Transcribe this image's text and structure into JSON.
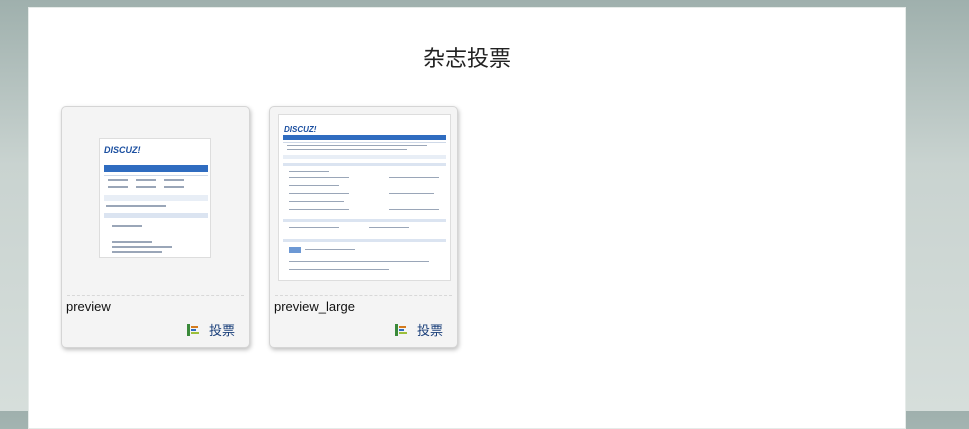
{
  "page": {
    "title": "杂志投票"
  },
  "cards": [
    {
      "name": "preview",
      "vote_label": "投票",
      "logo": "DISCUZ!"
    },
    {
      "name": "preview_large",
      "vote_label": "投票",
      "logo": "DISCUZ!"
    }
  ],
  "icons": {
    "vote": "bar-chart-icon"
  },
  "colors": {
    "accent": "#1a3f7a",
    "bar": "#2f6cc0"
  }
}
